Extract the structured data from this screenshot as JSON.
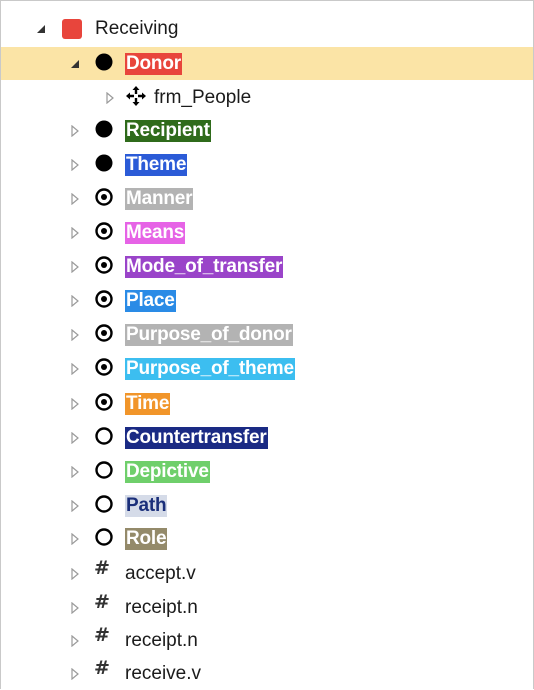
{
  "tree": {
    "root": {
      "label": "Receiving",
      "icon": "red-square-icon",
      "color": "#e8453c",
      "expanded": true,
      "children": [
        {
          "label": "Donor",
          "icon": "filled-circle-icon",
          "bg": "#e8453c",
          "fg": "#ffffff",
          "selected": true,
          "expanded": true,
          "children": [
            {
              "label": "frm_People",
              "icon": "move-arrows-icon"
            }
          ]
        },
        {
          "label": "Recipient",
          "icon": "filled-circle-icon",
          "bg": "#2f6b1b",
          "fg": "#ffffff"
        },
        {
          "label": "Theme",
          "icon": "filled-circle-icon",
          "bg": "#2b5bd7",
          "fg": "#ffffff"
        },
        {
          "label": "Manner",
          "icon": "dot-circle-icon",
          "bg": "#b3b3b3",
          "fg": "#ffffff"
        },
        {
          "label": "Means",
          "icon": "dot-circle-icon",
          "bg": "#e663e6",
          "fg": "#ffffff"
        },
        {
          "label": "Mode_of_transfer",
          "icon": "dot-circle-icon",
          "bg": "#9a44c9",
          "fg": "#ffffff"
        },
        {
          "label": "Place",
          "icon": "dot-circle-icon",
          "bg": "#2a8be6",
          "fg": "#ffffff"
        },
        {
          "label": "Purpose_of_donor",
          "icon": "dot-circle-icon",
          "bg": "#b3b3b3",
          "fg": "#ffffff"
        },
        {
          "label": "Purpose_of_theme",
          "icon": "dot-circle-icon",
          "bg": "#3cbef0",
          "fg": "#ffffff"
        },
        {
          "label": "Time",
          "icon": "dot-circle-icon",
          "bg": "#f1952a",
          "fg": "#ffffff"
        },
        {
          "label": "Countertransfer",
          "icon": "open-circle-icon",
          "bg": "#1a2a84",
          "fg": "#ffffff"
        },
        {
          "label": "Depictive",
          "icon": "open-circle-icon",
          "bg": "#6fcf6b",
          "fg": "#ffffff"
        },
        {
          "label": "Path",
          "icon": "open-circle-icon",
          "bg": "#d5dbe8",
          "fg": "#1b2f7a"
        },
        {
          "label": "Role",
          "icon": "open-circle-icon",
          "bg": "#948a6a",
          "fg": "#ffffff"
        },
        {
          "label": "accept.v",
          "icon": "hash-icon"
        },
        {
          "label": "receipt.n",
          "icon": "hash-icon"
        },
        {
          "label": "receipt.n",
          "icon": "hash-icon"
        },
        {
          "label": "receive.v",
          "icon": "hash-icon"
        }
      ]
    }
  }
}
